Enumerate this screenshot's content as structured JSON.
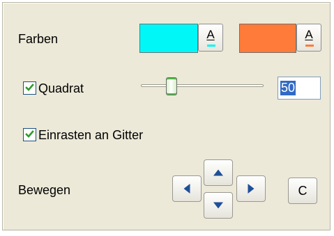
{
  "colors": {
    "label": "Farben",
    "swatch1": "#00f7f7",
    "swatch2": "#ff7b39",
    "text_button_label": "A"
  },
  "square": {
    "label": "Quadrat",
    "checked": true,
    "slider_fraction": 0.25,
    "value": "50"
  },
  "snap": {
    "label": "Einrasten an Gitter",
    "checked": true
  },
  "move": {
    "label": "Bewegen",
    "center_button_label": "C",
    "icons": [
      "arrow-up-icon",
      "arrow-left-icon",
      "arrow-right-icon",
      "arrow-down-icon"
    ]
  },
  "accent": "#2f9a2a"
}
